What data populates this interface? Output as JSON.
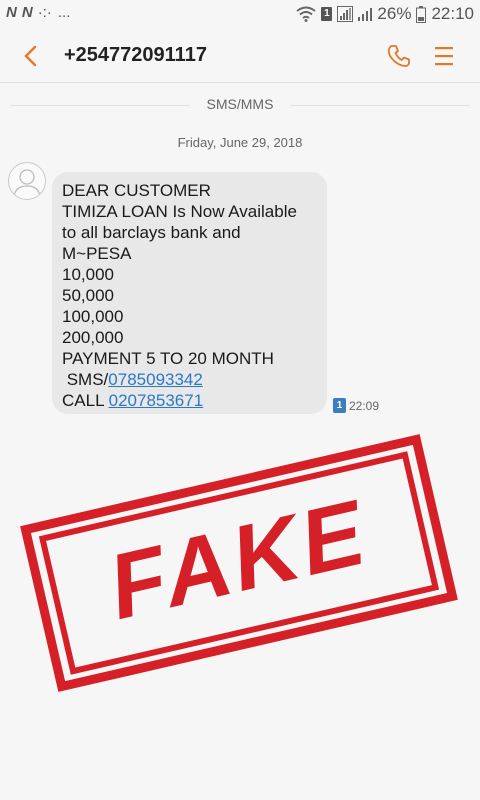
{
  "status_bar": {
    "left_icons": [
      "N",
      "N",
      "·:·",
      "..."
    ],
    "battery_percent": "26%",
    "time": "22:10",
    "sim_indicator": "1"
  },
  "header": {
    "contact": "+254772091117",
    "back_icon": "chevron-left-icon",
    "call_icon": "phone-icon",
    "menu_icon": "menu-icon"
  },
  "thread": {
    "channel_label": "SMS/MMS",
    "date": "Friday, June 29, 2018",
    "message": {
      "lines": [
        "DEAR CUSTOMER",
        "TIMIZA LOAN Is Now Available",
        "to all barclays bank and",
        "M~PESA",
        "10,000",
        "50,000",
        "100,000",
        "200,000",
        "PAYMENT 5 TO 20 MONTH"
      ],
      "sms_prefix": " SMS/",
      "sms_number": "0785093342",
      "call_prefix": "CALL ",
      "call_number": "0207853671",
      "sim": "1",
      "time": "22:09"
    }
  },
  "stamp": {
    "text": "FAKE",
    "color": "#d62027"
  },
  "colors": {
    "accent": "#e07a2a",
    "link": "#2a79c9",
    "bubble": "#e8e8e8"
  }
}
